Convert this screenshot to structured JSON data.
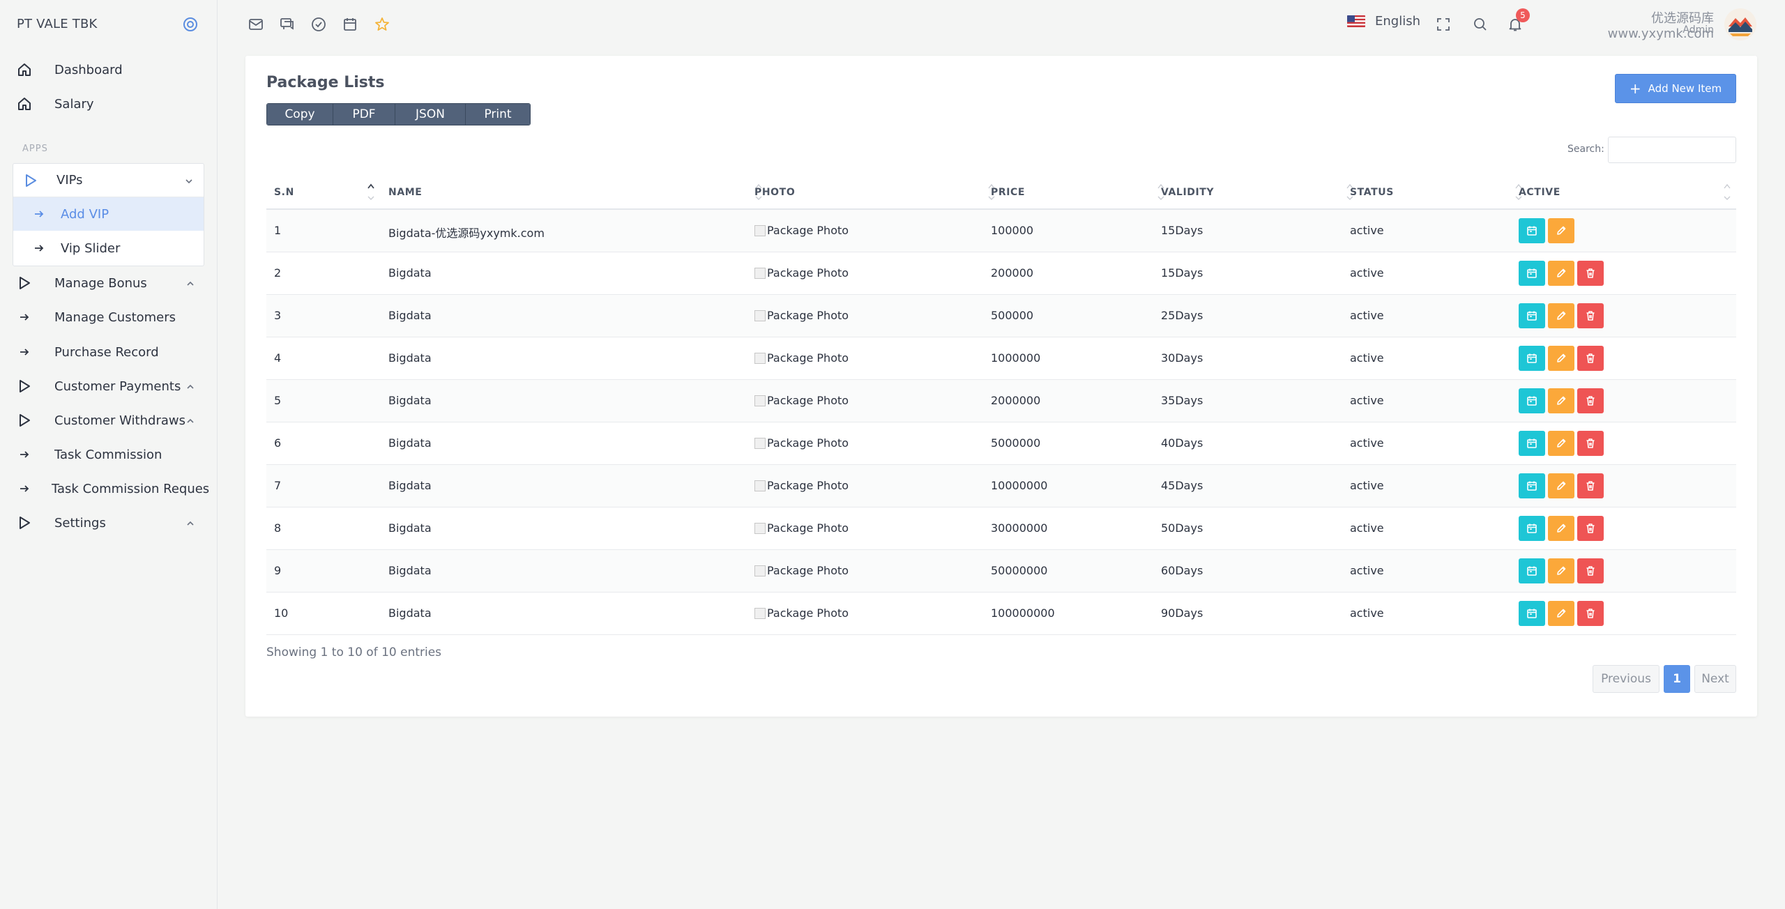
{
  "sidebar": {
    "brand": "PT VALE TBK",
    "items_top": [
      {
        "label": "Dashboard",
        "icon": "home-icon"
      },
      {
        "label": "Salary",
        "icon": "home-icon"
      }
    ],
    "section_label": "APPS",
    "vip_group": {
      "label": "VIPs",
      "children": [
        {
          "label": "Add VIP",
          "active": true
        },
        {
          "label": "Vip Slider",
          "active": false
        }
      ]
    },
    "items_bottom": [
      {
        "label": "Manage Bonus",
        "icon": "play-icon",
        "expandable": true
      },
      {
        "label": "Manage Customers",
        "icon": "arrow-right-icon",
        "expandable": false
      },
      {
        "label": "Purchase Record",
        "icon": "arrow-right-icon",
        "expandable": false
      },
      {
        "label": "Customer Payments",
        "icon": "play-icon",
        "expandable": true
      },
      {
        "label": "Customer Withdraws",
        "icon": "play-icon",
        "expandable": true
      },
      {
        "label": "Task Commission",
        "icon": "arrow-right-icon",
        "expandable": false
      },
      {
        "label": "Task Commission Reques",
        "icon": "arrow-right-icon",
        "expandable": false
      },
      {
        "label": "Settings",
        "icon": "play-icon",
        "expandable": true
      }
    ]
  },
  "topbar": {
    "icons": [
      "mail-icon",
      "chat-icon",
      "check-circle-icon",
      "calendar-icon",
      "star-icon"
    ],
    "language": "English",
    "notification_count": "5",
    "user_name": "优选源码库 www.yxymk.com",
    "user_role": "Admin"
  },
  "card": {
    "title": "Package Lists",
    "export_buttons": [
      "Copy",
      "PDF",
      "JSON",
      "Print"
    ],
    "add_button": "Add New Item",
    "search_label": "Search:",
    "search_value": ""
  },
  "table": {
    "columns": [
      "S.N",
      "NAME",
      "PHOTO",
      "PRICE",
      "VALIDITY",
      "STATUS",
      "ACTIVE"
    ],
    "rows": [
      {
        "sn": "1",
        "name": "Bigdata-优选源码yxymk.com",
        "photo": "Package Photo",
        "price": "100000",
        "validity": "15Days",
        "status": "active",
        "delete": false
      },
      {
        "sn": "2",
        "name": "Bigdata",
        "photo": "Package Photo",
        "price": "200000",
        "validity": "15Days",
        "status": "active",
        "delete": true
      },
      {
        "sn": "3",
        "name": "Bigdata",
        "photo": "Package Photo",
        "price": "500000",
        "validity": "25Days",
        "status": "active",
        "delete": true
      },
      {
        "sn": "4",
        "name": "Bigdata",
        "photo": "Package Photo",
        "price": "1000000",
        "validity": "30Days",
        "status": "active",
        "delete": true
      },
      {
        "sn": "5",
        "name": "Bigdata",
        "photo": "Package Photo",
        "price": "2000000",
        "validity": "35Days",
        "status": "active",
        "delete": true
      },
      {
        "sn": "6",
        "name": "Bigdata",
        "photo": "Package Photo",
        "price": "5000000",
        "validity": "40Days",
        "status": "active",
        "delete": true
      },
      {
        "sn": "7",
        "name": "Bigdata",
        "photo": "Package Photo",
        "price": "10000000",
        "validity": "45Days",
        "status": "active",
        "delete": true
      },
      {
        "sn": "8",
        "name": "Bigdata",
        "photo": "Package Photo",
        "price": "30000000",
        "validity": "50Days",
        "status": "active",
        "delete": true
      },
      {
        "sn": "9",
        "name": "Bigdata",
        "photo": "Package Photo",
        "price": "50000000",
        "validity": "60Days",
        "status": "active",
        "delete": true
      },
      {
        "sn": "10",
        "name": "Bigdata",
        "photo": "Package Photo",
        "price": "100000000",
        "validity": "90Days",
        "status": "active",
        "delete": true
      }
    ]
  },
  "pagination": {
    "info": "Showing 1 to 10 of 10 entries",
    "previous": "Previous",
    "current": "1",
    "next": "Next"
  },
  "colors": {
    "accent": "#5b93e8",
    "view": "#1ec6d6",
    "edit": "#fba83a",
    "delete": "#ef5454"
  }
}
